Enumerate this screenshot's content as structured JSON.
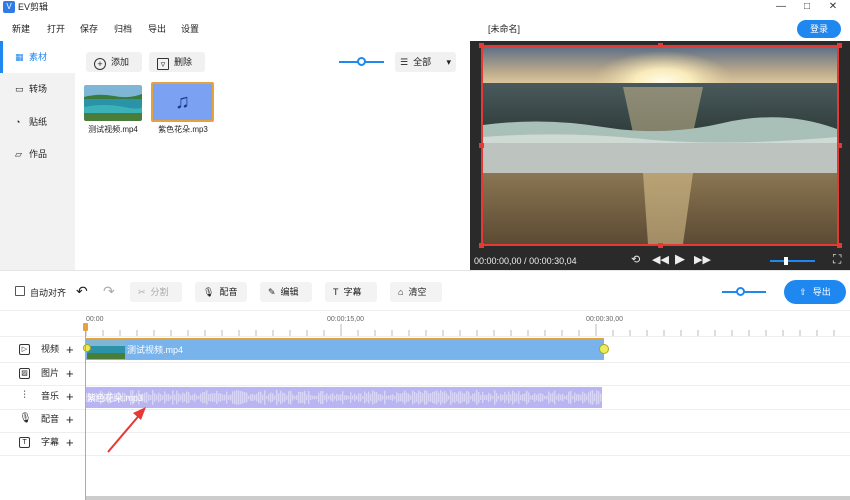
{
  "app": {
    "title": "EV剪辑",
    "logo_glyph": "V",
    "window_controls": [
      "—",
      "□",
      "✕"
    ]
  },
  "menu": [
    "新建",
    "打开",
    "保存",
    "归档",
    "导出",
    "设置"
  ],
  "document_title": "[未命名]",
  "login_label": "登录",
  "sidebar": {
    "items": [
      {
        "label": "素材",
        "icon": "grid-icon",
        "active": true
      },
      {
        "label": "转场",
        "icon": "film-icon",
        "active": false
      },
      {
        "label": "贴纸",
        "icon": "sticker-icon",
        "active": false
      },
      {
        "label": "作品",
        "icon": "folder-icon",
        "active": false
      }
    ]
  },
  "library": {
    "add_label": "添加",
    "delete_label": "删除",
    "filter_value": "全部",
    "files": [
      {
        "name": "测试视频.mp4",
        "type": "video",
        "selected": false
      },
      {
        "name": "紫色花朵.mp3",
        "type": "audio",
        "selected": true
      }
    ]
  },
  "preview": {
    "time_current": "00:00:00,00",
    "time_total": "00:00:30,04",
    "time_separator": " / "
  },
  "edit_toolbar": {
    "auto_align_label": "自动对齐",
    "split_label": "分割",
    "voiceover_label": "配音",
    "edit_label": "编辑",
    "subtitle_label": "字幕",
    "clear_label": "清空",
    "export_label": "导出"
  },
  "timeline": {
    "ruler_ticks": [
      "00:00",
      "00:00:15,00",
      "00:00:30,00"
    ],
    "tracks": [
      {
        "label": "视频",
        "icon": "play-icon"
      },
      {
        "label": "图片",
        "icon": "image-icon"
      },
      {
        "label": "音乐",
        "icon": "waveform-icon"
      },
      {
        "label": "配音",
        "icon": "microphone-icon"
      },
      {
        "label": "字幕",
        "icon": "text-icon"
      }
    ],
    "video_clip_label": "测试视频.mp4",
    "audio_clip_label": "紫色花朵.mp3"
  },
  "colors": {
    "accent": "#1f87f0",
    "selection_red": "#e53935",
    "clip_video": "#79b3ec",
    "clip_audio": "#b9b4f2",
    "playhead": "#e6a23c"
  }
}
